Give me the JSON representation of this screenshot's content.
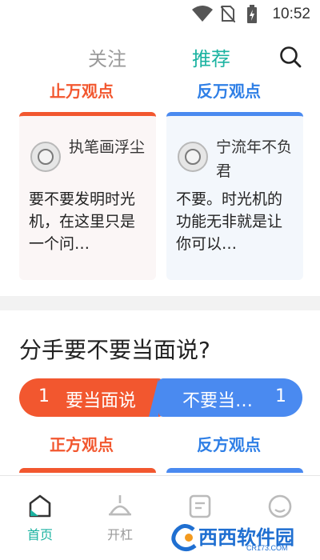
{
  "status_bar": {
    "time": "10:52",
    "icons": [
      "wifi-icon",
      "no-sim-icon",
      "battery-charging-icon"
    ]
  },
  "top_tabs": {
    "follow": "关注",
    "recommend": "推荐",
    "active": "recommend",
    "search_icon": "search-icon"
  },
  "featured": {
    "pro_title": "止万观点",
    "con_title": "反万观点",
    "pro_card": {
      "author": "执笔画浮尘",
      "excerpt": "要不要发明时光机，在这里只是一个问…"
    },
    "con_card": {
      "author": "宁流年不负君",
      "excerpt": "不要。时光机的功能无非就是让你可以…"
    }
  },
  "topic": {
    "question": "分手要不要当面说?",
    "pro_option": {
      "count": "1",
      "label": "要当面说"
    },
    "con_option": {
      "count": "1",
      "label": "不要当…"
    },
    "pro_title": "正方观点",
    "con_title": "反方观点"
  },
  "bottom_nav": {
    "items": [
      {
        "label": "首页",
        "icon": "home-icon",
        "active": true
      },
      {
        "label": "开杠",
        "icon": "debate-icon",
        "active": false
      },
      {
        "label": "",
        "icon": "document-icon",
        "active": false
      },
      {
        "label": "",
        "icon": "profile-icon",
        "active": false
      }
    ]
  },
  "watermark": {
    "text": "西西软件园",
    "sub": "CR173.COM"
  },
  "colors": {
    "accent": "#1bb3a1",
    "pro": "#f2572f",
    "con": "#4a8af0"
  }
}
